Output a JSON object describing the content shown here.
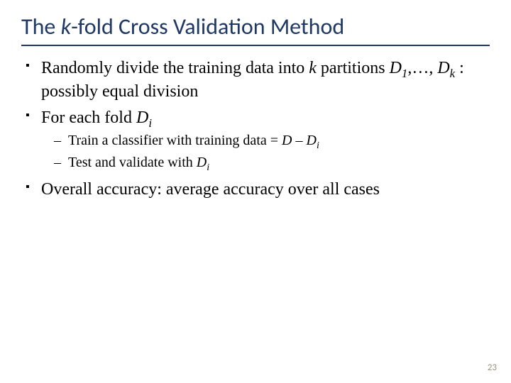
{
  "title": {
    "pre": "The ",
    "k": "k",
    "post": "-fold Cross Validation Method"
  },
  "b1": {
    "a": "Randomly divide the training data into ",
    "k": "k",
    "b": " partitions ",
    "D": "D",
    "s1": "1",
    "dots": ",…, ",
    "D2": "D",
    "sk": "k",
    "c": " : possibly equal division"
  },
  "b2": {
    "a": "For each fold ",
    "D": "D",
    "si": "i"
  },
  "s1": {
    "a": "Train a classifier with training data = ",
    "D": "D",
    "minus": " – ",
    "D2": "D",
    "si": "i"
  },
  "s2": {
    "a": "Test and validate with ",
    "D": "D",
    "si": "i"
  },
  "b3": "Overall accuracy: average accuracy over all cases",
  "page": "23"
}
